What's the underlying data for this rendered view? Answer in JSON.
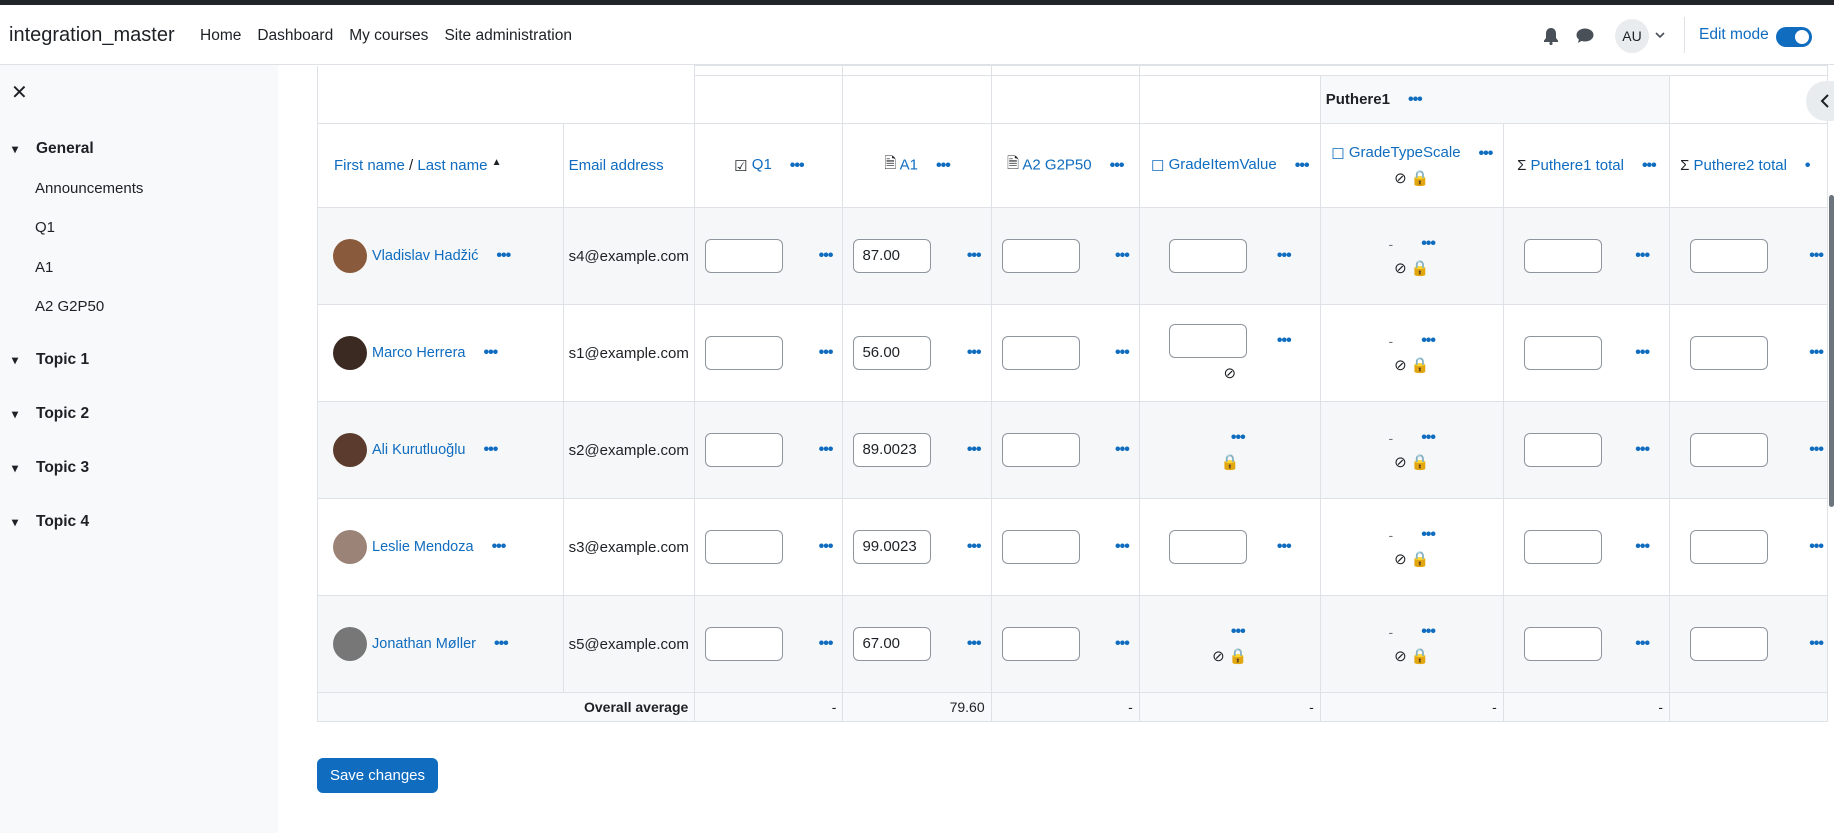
{
  "site_name": "integration_master",
  "nav": [
    "Home",
    "Dashboard",
    "My courses",
    "Site administration"
  ],
  "user_initials": "AU",
  "edit_mode_label": "Edit mode",
  "drawer": {
    "sections": [
      {
        "label": "General",
        "items": [
          "Announcements",
          "Q1",
          "A1",
          "A2 G2P50"
        ]
      },
      {
        "label": "Topic 1",
        "items": []
      },
      {
        "label": "Topic 2",
        "items": []
      },
      {
        "label": "Topic 3",
        "items": []
      },
      {
        "label": "Topic 4",
        "items": []
      }
    ]
  },
  "grader": {
    "category_title": "Puthere1",
    "name_header": {
      "first": "First name",
      "sep": " / ",
      "last": "Last name"
    },
    "email_header": "Email address",
    "columns": [
      {
        "label": "Q1",
        "icon": "quiz-icon"
      },
      {
        "label": "A1",
        "icon": "assignment-icon"
      },
      {
        "label": "A2 G2P50",
        "icon": "assignment-icon"
      },
      {
        "label": "GradeItemValue",
        "icon": "manual-item-icon"
      },
      {
        "label": "GradeTypeScale",
        "icon": "manual-item-icon"
      },
      {
        "label": "Puthere1 total",
        "icon": "sigma-icon"
      },
      {
        "label": "Puthere2 total",
        "icon": "sigma-icon"
      }
    ],
    "rows": [
      {
        "name": "Vladislav Hadžić",
        "email": "s4@example.com",
        "a1": "87.00",
        "scale": "-"
      },
      {
        "name": "Marco Herrera",
        "email": "s1@example.com",
        "a1": "56.00",
        "scale": "-"
      },
      {
        "name": "Ali Kurutluoğlu",
        "email": "s2@example.com",
        "a1": "89.0023",
        "scale": "-"
      },
      {
        "name": "Leslie Mendoza",
        "email": "s3@example.com",
        "a1": "99.0023",
        "scale": "-"
      },
      {
        "name": "Jonathan Møller",
        "email": "s5@example.com",
        "a1": "67.00",
        "scale": "-"
      }
    ],
    "average_label": "Overall average",
    "averages": [
      "-",
      "79.60",
      "-",
      "-",
      "-",
      "-"
    ]
  },
  "save_label": "Save changes"
}
